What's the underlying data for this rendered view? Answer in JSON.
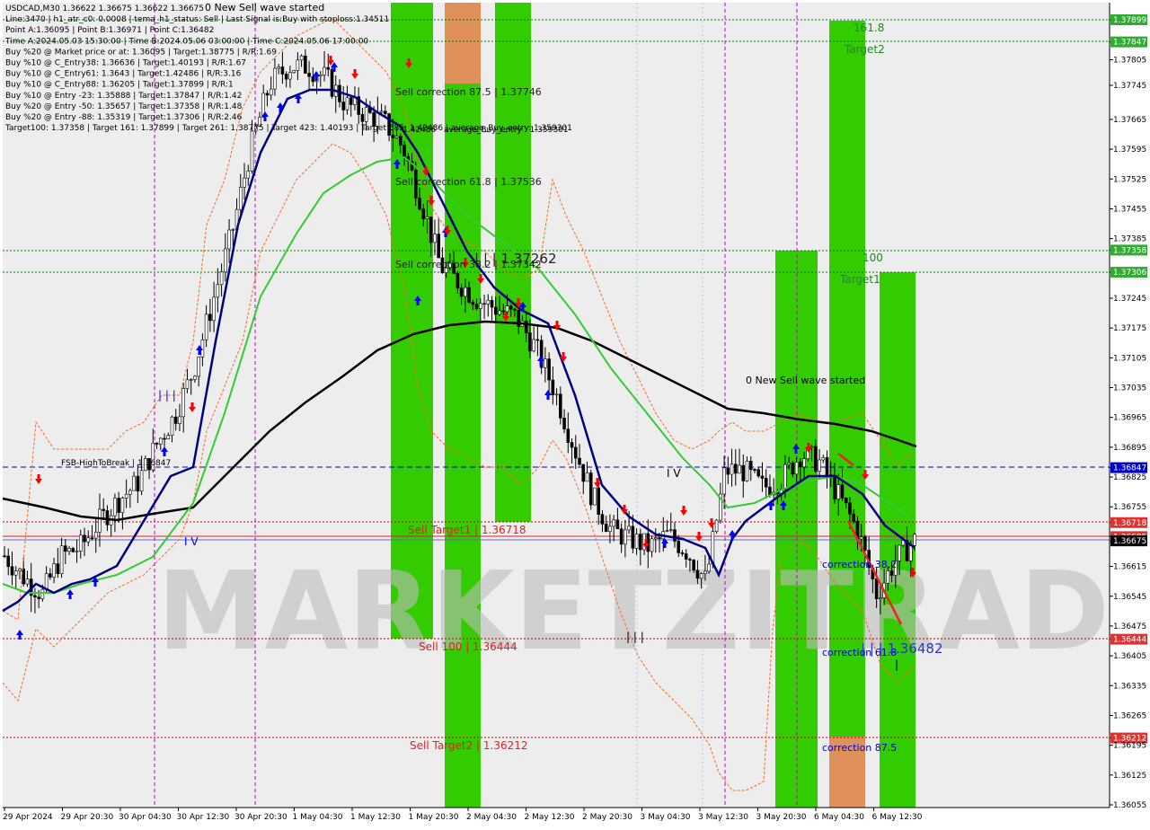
{
  "colors": {
    "bg": "#ffffff",
    "plot_bg": "#ebebeb",
    "green_zone": "#33cc00",
    "green_zone_light": "#66ee00",
    "orange_zone": "#e0905a",
    "dark_line": "#000000",
    "navy_line": "#000080",
    "green_line": "#33cc33",
    "red_line": "#e03020",
    "red_dot_line": "#cc0000",
    "green_dot_line": "#008000",
    "blue_dash_line": "#0000cc",
    "magenta_dash": "#cc00cc",
    "buy_arrow": "#0000ff",
    "sell_arrow": "#ff0000",
    "watermark": "#c0c0c0"
  },
  "header": {
    "lines": [
      "USDCAD,M30  1.36622 1.36675 1.36622 1.36675",
      "Line:3470 | h1_atr_c0: 0.0008 | tema_h1_status: Sell | Last Signal is:Buy with stoploss:1.34511",
      "Point A:1.36095 | Point B:1.36971 | Point C:1.36482",
      "Time A:2024.05.03 15:30:00 | Time B:2024.05.06 03:00:00 | Time C:2024.05.06 17:00:00",
      "Buy %20 @ Market price or at: 1.36095 | Target:1.38775 | R/R:1.69",
      "Buy %10 @ C_Entry38: 1.36636 | Target:1.40193 | R/R:1.67",
      "Buy %10 @ C_Entry61: 1.3643 | Target:1.42486 | R/R:3.16",
      "Buy %10 @ C_Entry88: 1.36205 | Target:1.37899 | R/R:1",
      "Buy %10 @ Entry -23: 1.35888 | Target:1.37847 | R/R:1.42",
      "Buy %20 @ Entry -50: 1.35657 | Target:1.37358 | R/R:1.48",
      "Buy %20 @ Entry -88: 1.35319 | Target:1.37306 | R/R:2.46",
      "Target100: 1.37358 | Target 161: 1.37899 | Target 261: 1.38775 | Target 423: 1.40193 | Target 685: 1.42486 | average_Buy_entry: 1.359301"
    ]
  },
  "watermark_text": "MARKETZITRADE",
  "y_axis": {
    "min": 1.36055,
    "max": 1.37899,
    "ticks": [
      "1.37899",
      "1.37847",
      "1.37805",
      "1.37745",
      "1.37665",
      "1.37595",
      "1.37525",
      "1.37455",
      "1.37385",
      "1.37358",
      "1.37306",
      "1.37245",
      "1.37175",
      "1.37105",
      "1.37035",
      "1.36965",
      "1.36895",
      "1.36847",
      "1.36825",
      "1.36755",
      "1.36718",
      "1.36685",
      "1.36675",
      "1.36615",
      "1.36545",
      "1.36475",
      "1.36444",
      "1.36405",
      "1.36335",
      "1.36265",
      "1.36212",
      "1.36195",
      "1.36125",
      "1.36055"
    ],
    "boxes": [
      {
        "label": "1.37899",
        "color": "#33aa33"
      },
      {
        "label": "1.37847",
        "color": "#33aa33"
      },
      {
        "label": "1.37358",
        "color": "#33aa33"
      },
      {
        "label": "1.37306",
        "color": "#33aa33"
      },
      {
        "label": "1.36847",
        "color": "#0000cc"
      },
      {
        "label": "1.36718",
        "color": "#dd3333"
      },
      {
        "label": "1.36685",
        "color": "#dd3333"
      },
      {
        "label": "1.36675",
        "color": "#000000"
      },
      {
        "label": "1.36444",
        "color": "#dd3333"
      },
      {
        "label": "1.36212",
        "color": "#dd3333"
      }
    ]
  },
  "x_axis": {
    "labels": [
      "29 Apr 2024",
      "29 Apr 20:30",
      "30 Apr 04:30",
      "30 Apr 12:30",
      "30 Apr 20:30",
      "1 May 04:30",
      "1 May 12:30",
      "1 May 20:30",
      "2 May 04:30",
      "2 May 12:30",
      "2 May 20:30",
      "3 May 04:30",
      "3 May 12:30",
      "3 May 20:30",
      "6 May 04:30",
      "6 May 12:30"
    ]
  },
  "annotations": {
    "new_sell_top": "0 New Sell wave started",
    "new_sell_mid": "0 New Sell wave started",
    "sell_corr_875": "Sell correction 87.5 | 1.37746",
    "sell_corr_618": "Sell correction 61.8 | 1.37536",
    "sell_corr_382": "Sell correction 38.2 | 1.37342",
    "level_37262": "| | | 1.37262",
    "avg_buy": "average_Buy_entry : 1.359301",
    "value_42486": "1.42486",
    "fsb": "FSB-HighToBreak | 1.36847",
    "sell_target1": "Sell Target1 | 1.36718",
    "sell_100": "Sell 100 | 1.36444",
    "sell_target2": "Sell Target2 | 1.36212",
    "t1618": "161.8",
    "target2": "Target2",
    "t100": "100",
    "target1": "Target1",
    "corr382": "correction 38.2",
    "corr618": "correction 61.8",
    "corr875": "correction 87.5",
    "c_level": "| | | 1.36482",
    "wave3": "| | |",
    "wave4": "I V",
    "wave4b": "I V",
    "wave_bottom": "| | |",
    "wave_i": "|"
  },
  "chart_data": {
    "type": "line",
    "symbol": "USDCAD",
    "timeframe": "M30",
    "ylim": [
      1.36055,
      1.37899
    ],
    "series": [
      {
        "name": "price",
        "values": [
          1.3664,
          1.3659,
          1.3655,
          1.3664,
          1.3666,
          1.3672,
          1.3677,
          1.3681,
          1.369,
          1.3697,
          1.3708,
          1.3724,
          1.374,
          1.376,
          1.3775,
          1.3779,
          1.3779,
          1.3776,
          1.377,
          1.3768,
          1.3766,
          1.376,
          1.3747,
          1.3732,
          1.3728,
          1.3724,
          1.3722,
          1.372,
          1.3713,
          1.3703,
          1.369,
          1.3678,
          1.367,
          1.3668,
          1.3666,
          1.3669,
          1.3665,
          1.3658,
          1.3684,
          1.3684,
          1.368,
          1.3682,
          1.3688,
          1.3686,
          1.3678,
          1.367,
          1.3655,
          1.3663,
          1.36675
        ]
      }
    ],
    "levels": [
      {
        "name": "Target 161",
        "value": 1.37899
      },
      {
        "name": "Target 100",
        "value": 1.37358
      },
      {
        "name": "FSB-HighToBreak",
        "value": 1.36847
      },
      {
        "name": "Sell Target1",
        "value": 1.36718
      },
      {
        "name": "Sell 100",
        "value": 1.36444
      },
      {
        "name": "Sell Target2",
        "value": 1.36212
      }
    ]
  }
}
